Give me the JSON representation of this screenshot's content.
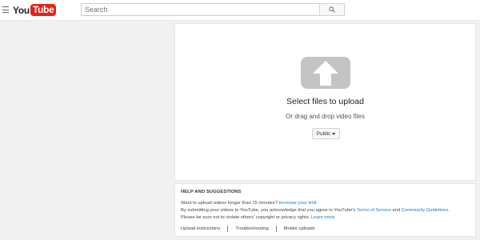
{
  "header": {
    "logo": {
      "you": "You",
      "tube": "Tube"
    },
    "search": {
      "placeholder": "Search"
    }
  },
  "upload": {
    "title": "Select files to upload",
    "subtitle": "Or drag and drop video files",
    "privacy_selected": "Public"
  },
  "help": {
    "title": "HELP AND SUGGESTIONS",
    "line1_text": "Want to upload videos longer than 15 minutes?",
    "line1_link": "Increase your limit",
    "line2_text": "By submitting your videos to YouTube, you acknowledge that you agree to YouTube's",
    "line2_link_tos": "Terms of Service",
    "line2_and": "and",
    "line2_link_guidelines": "Community Guidelines",
    "line3_text": "Please be sure not to violate others' copyright or privacy rights.",
    "line3_link": "Learn more",
    "links": [
      "Upload instructions",
      "Troubleshooting",
      "Mobile uploads"
    ]
  },
  "colors": {
    "brand": "#e62117",
    "link": "#167ac6",
    "upload_icon": "#c4c4c4"
  }
}
